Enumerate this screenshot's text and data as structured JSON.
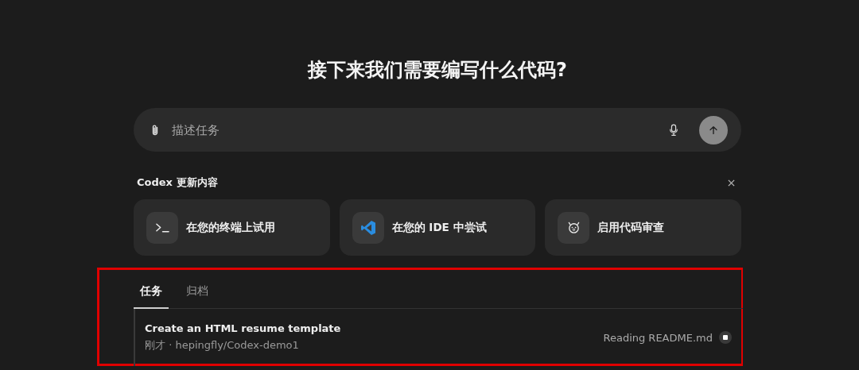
{
  "heading": "接下来我们需要编写什么代码?",
  "composer": {
    "placeholder": "描述任务"
  },
  "updates": {
    "title": "Codex 更新内容",
    "cards": [
      {
        "kind": "terminal",
        "label": "在您的终端上试用"
      },
      {
        "kind": "ide",
        "label": "在您的 IDE 中尝试"
      },
      {
        "kind": "review",
        "label": "启用代码审查"
      }
    ]
  },
  "tabs": [
    {
      "label": "任务",
      "selected": true
    },
    {
      "label": "归档",
      "selected": false
    }
  ],
  "tasks": [
    {
      "title": "Create an HTML resume template",
      "meta": "刚才 · hepingfly/Codex-demo1",
      "status": "Reading README.md",
      "running": true
    }
  ]
}
